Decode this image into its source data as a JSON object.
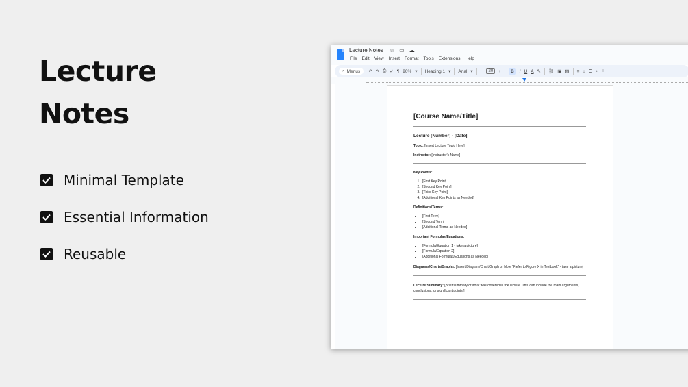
{
  "hero": {
    "title_line1": "Lecture",
    "title_line2": "Notes"
  },
  "features": [
    {
      "label": "Minimal Template"
    },
    {
      "label": "Essential Information"
    },
    {
      "label": "Reusable"
    }
  ],
  "app": {
    "doc_title": "Lecture Notes",
    "menus": [
      "File",
      "Edit",
      "View",
      "Insert",
      "Format",
      "Tools",
      "Extensions",
      "Help"
    ],
    "toolbar": {
      "search": "Menus",
      "zoom": "90%",
      "style": "Heading 1",
      "font": "Arial",
      "font_size": "20",
      "minus": "−",
      "plus": "+",
      "bold": "B",
      "italic": "I",
      "underline": "U",
      "text_color": "A"
    }
  },
  "doc": {
    "title": "[Course Name/Title]",
    "lecture": "Lecture [Number] - [Date]",
    "topic_label": "Topic:",
    "topic_value": " [Insert Lecture Topic Here]",
    "instructor_label": "Instructor:",
    "instructor_value": " [Instructor's Name]",
    "key_points_heading": "Key Points:",
    "key_points": [
      "[First Key Point]",
      "[Second Key Point]",
      "[Third Key Point]",
      "[Additional Key Points as Needed]"
    ],
    "terms_heading": "Definitions/Terms:",
    "terms": [
      "[First Term]",
      "[Second Term]",
      "[Additional Terms as Needed]"
    ],
    "formulas_heading": "Important Formulas/Equations:",
    "formulas": [
      "[Formula/Equation 1 - take a picture]",
      "[Formula/Equation 2]",
      "[Additional Formulas/Equations as Needed]"
    ],
    "diagrams_label": "Diagrams/Charts/Graphs:",
    "diagrams_value": " [Insert Diagram/Chart/Graph or Note \"Refer to Figure X in Textbook\" - take a picture]",
    "summary_label": "Lecture Summary:",
    "summary_value": " [Brief summary of what was covered in the lecture. This can include the main arguments, conclusions, or significant points.]"
  }
}
